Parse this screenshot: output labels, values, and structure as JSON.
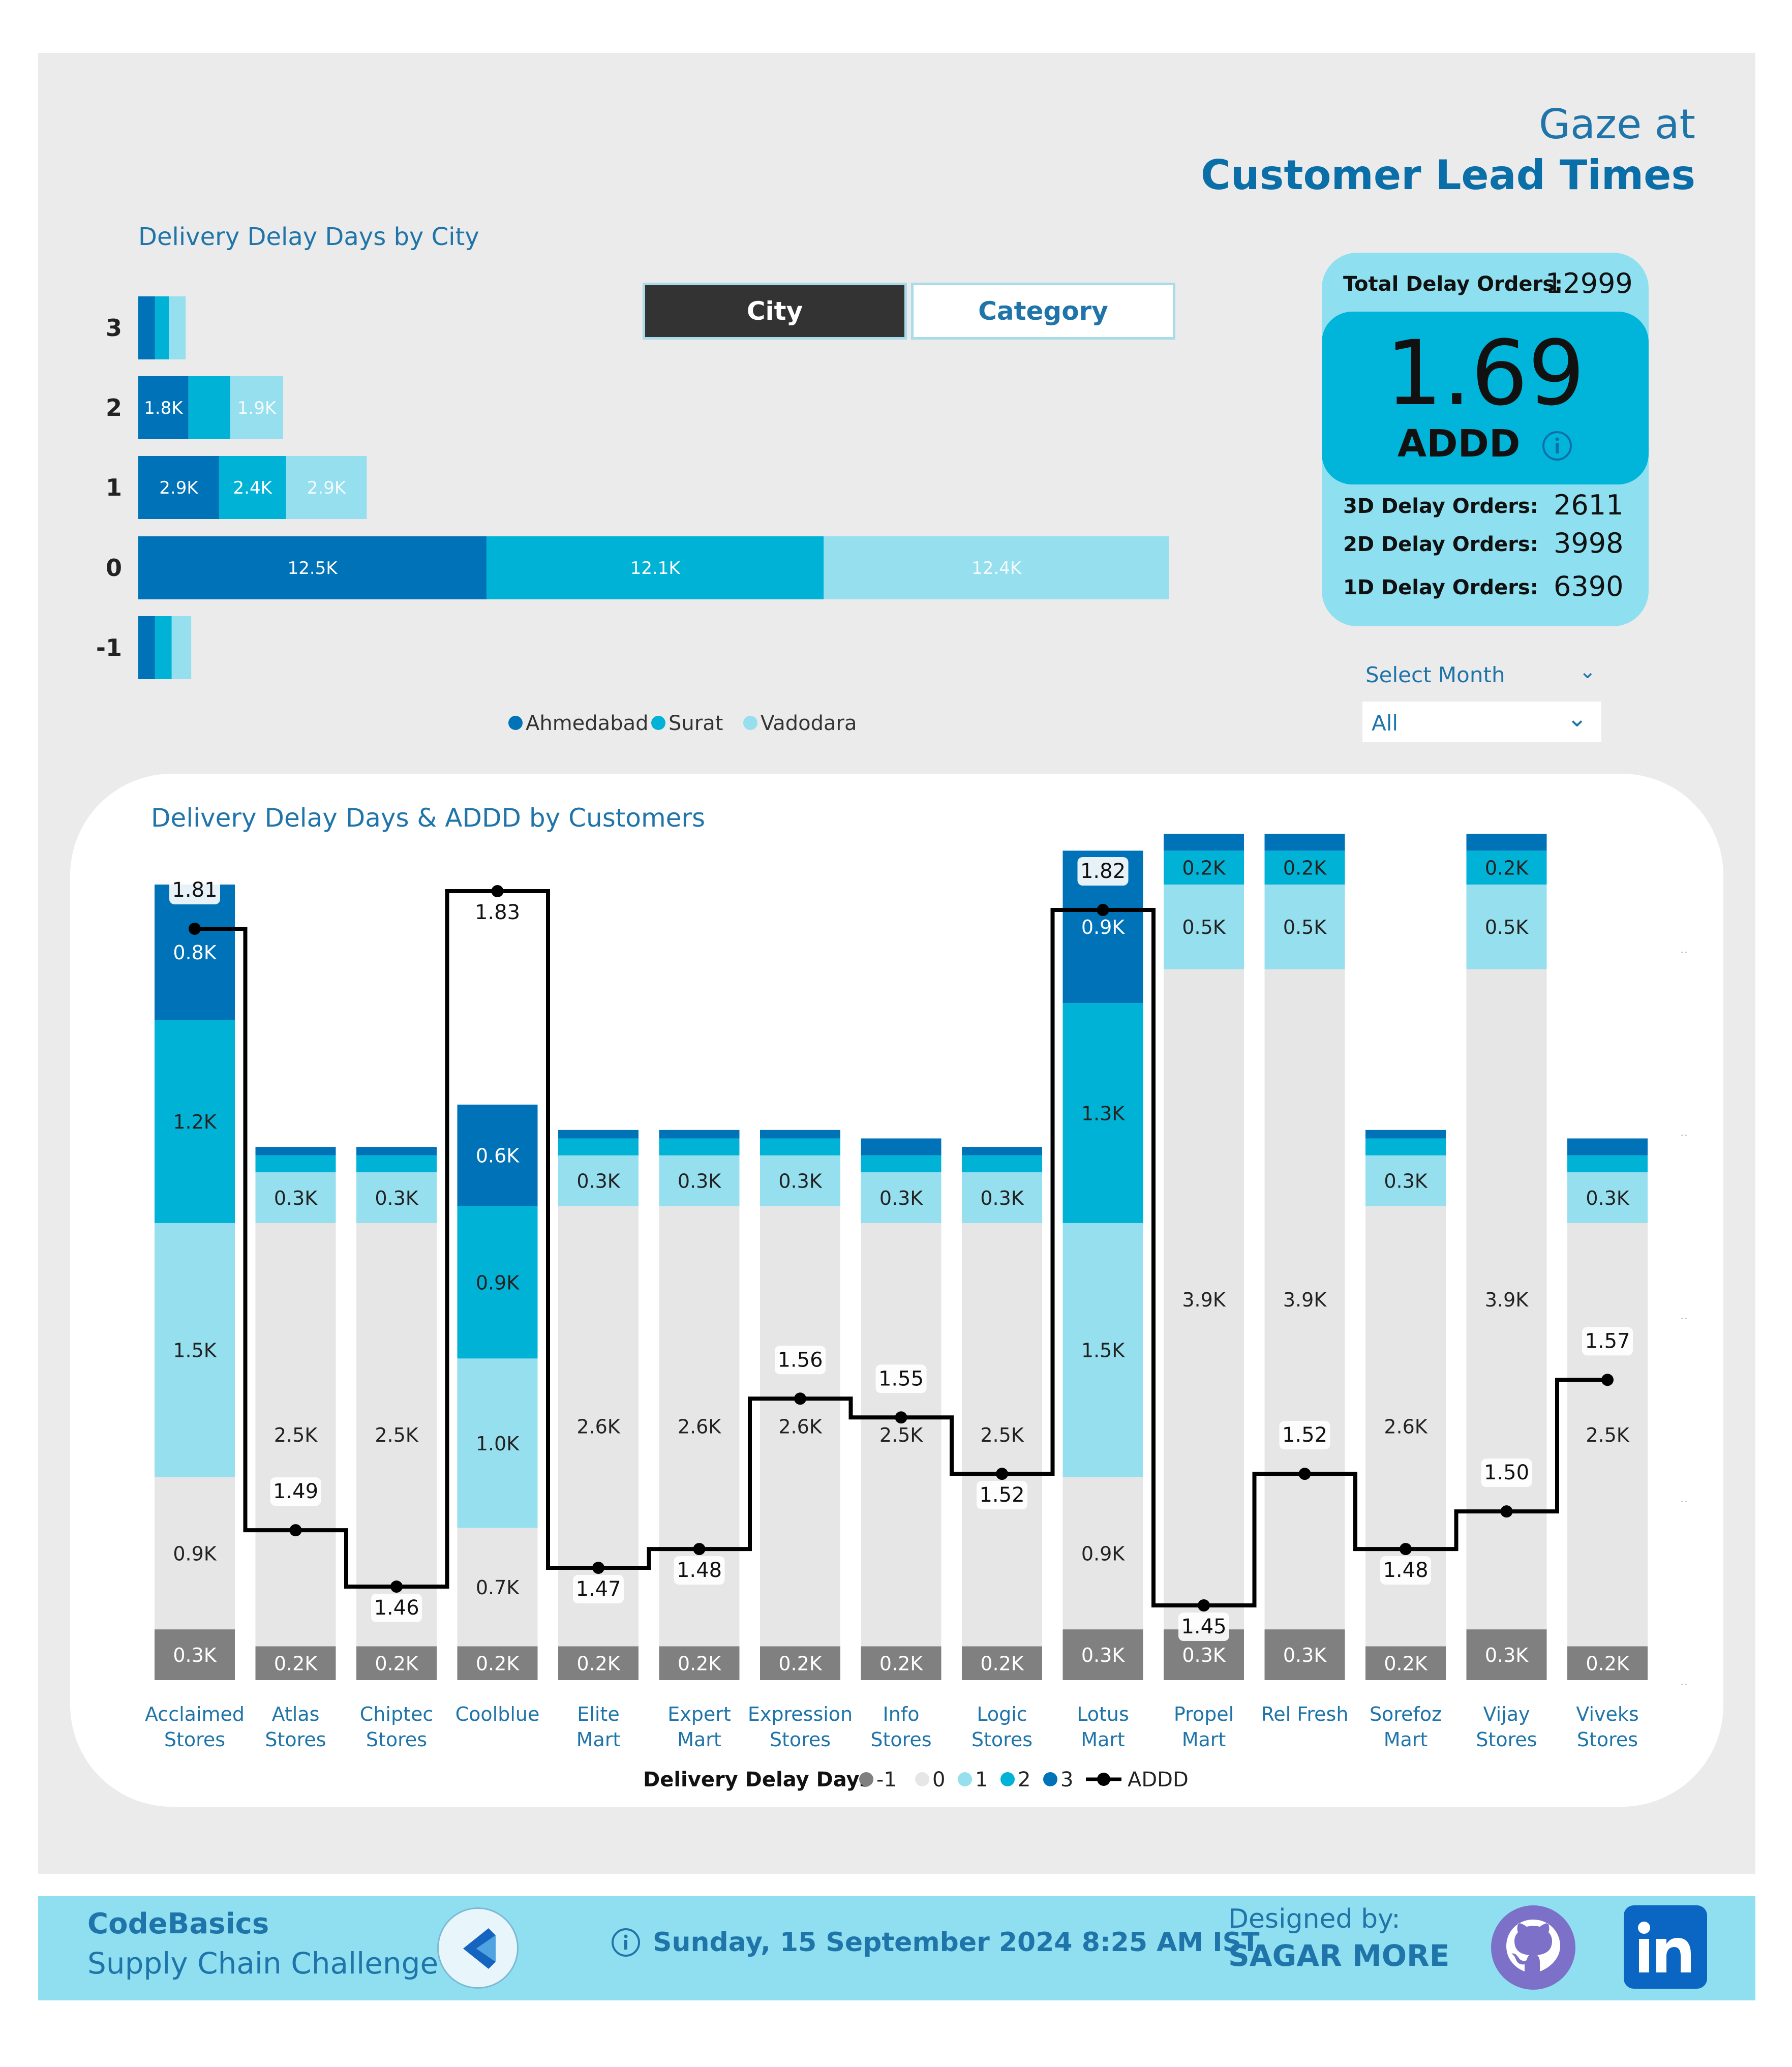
{
  "header": {
    "line1": "Gaze at",
    "line2": "Customer Lead Times"
  },
  "toggle": {
    "city_label": "City",
    "category_label": "Category",
    "selected": "City"
  },
  "kpi": {
    "total_label": "Total Delay Orders:",
    "total_value": "12999",
    "big_value": "1.69",
    "big_label": "ADDD",
    "d3_label": "3D Delay Orders:",
    "d3_value": "2611",
    "d2_label": "2D Delay Orders:",
    "d2_value": "3998",
    "d1_label": "1D Delay Orders:",
    "d1_value": "6390"
  },
  "month_filter": {
    "label": "Select Month",
    "value": "All"
  },
  "footer": {
    "brand_line1": "CodeBasics",
    "brand_line2": "Supply Chain Challenge",
    "date": "Sunday, 15 September 2024 8:25 AM IST",
    "designed_label": "Designed by:",
    "designer": "SAGAR MORE"
  },
  "colors": {
    "ahmedabad": "#0072b8",
    "surat": "#00b3d6",
    "vadodara": "#96dfee",
    "minus1": "#808080",
    "zero": "#e6e6e6",
    "one": "#96dfee",
    "two": "#00b3d6",
    "three": "#0072b8"
  },
  "chart_data": [
    {
      "type": "bar",
      "title": "Delivery Delay Days by City",
      "orientation": "horizontal",
      "stacked": true,
      "categories": [
        "3",
        "2",
        "1",
        "0",
        "-1"
      ],
      "series": [
        {
          "name": "Ahmedabad",
          "values": [
            0.6,
            1.8,
            2.9,
            12.5,
            0.6
          ],
          "labels": [
            "",
            "1.8K",
            "2.9K",
            "12.5K",
            ""
          ]
        },
        {
          "name": "Surat",
          "values": [
            0.5,
            1.5,
            2.4,
            12.1,
            0.6
          ],
          "labels": [
            "",
            "",
            "2.4K",
            "12.1K",
            ""
          ]
        },
        {
          "name": "Vadodara",
          "values": [
            0.6,
            1.9,
            2.9,
            12.4,
            0.7
          ],
          "labels": [
            "",
            "1.9K",
            "2.9K",
            "12.4K",
            ""
          ]
        }
      ],
      "legend": "bottom"
    },
    {
      "type": "bar",
      "title": "Delivery Delay Days & ADDD by Customers",
      "stacked": true,
      "categories": [
        "Acclaimed Stores",
        "Atlas Stores",
        "Chiptec Stores",
        "Coolblue",
        "Elite Mart",
        "Expert Mart",
        "Expression Stores",
        "Info Stores",
        "Logic Stores",
        "Lotus Mart",
        "Propel Mart",
        "Rel Fresh",
        "Sorefoz Mart",
        "Vijay Stores",
        "Viveks Stores"
      ],
      "legend_title": "Delivery Delay Days",
      "series": [
        {
          "name": "-1",
          "values": [
            0.3,
            0.2,
            0.2,
            0.2,
            0.2,
            0.2,
            0.2,
            0.2,
            0.2,
            0.3,
            0.3,
            0.3,
            0.2,
            0.3,
            0.2
          ]
        },
        {
          "name": "0",
          "values": [
            0.9,
            2.5,
            2.5,
            0.7,
            2.6,
            2.6,
            2.6,
            2.5,
            2.5,
            0.9,
            3.9,
            3.9,
            2.6,
            3.9,
            2.5
          ]
        },
        {
          "name": "1",
          "values": [
            1.5,
            0.3,
            0.3,
            1.0,
            0.3,
            0.3,
            0.3,
            0.3,
            0.3,
            1.5,
            0.5,
            0.5,
            0.3,
            0.5,
            0.3
          ]
        },
        {
          "name": "2",
          "values": [
            1.2,
            0.1,
            0.1,
            0.9,
            0.1,
            0.1,
            0.1,
            0.1,
            0.1,
            1.3,
            0.2,
            0.2,
            0.1,
            0.2,
            0.1
          ]
        },
        {
          "name": "3",
          "values": [
            0.8,
            0.05,
            0.05,
            0.6,
            0.05,
            0.05,
            0.05,
            0.1,
            0.05,
            0.9,
            0.1,
            0.1,
            0.05,
            0.1,
            0.1
          ]
        }
      ],
      "value_labels": {
        "-1": [
          "0.3K",
          "0.2K",
          "0.2K",
          "0.2K",
          "0.2K",
          "0.2K",
          "0.2K",
          "0.2K",
          "0.2K",
          "0.3K",
          "0.3K",
          "0.3K",
          "0.2K",
          "0.3K",
          "0.2K"
        ],
        "0": [
          "0.9K",
          "2.5K",
          "2.5K",
          "0.7K",
          "2.6K",
          "2.6K",
          "2.6K",
          "2.5K",
          "2.5K",
          "0.9K",
          "3.9K",
          "3.9K",
          "2.6K",
          "3.9K",
          "2.5K"
        ],
        "1": [
          "1.5K",
          "0.3K",
          "0.3K",
          "1.0K",
          "0.3K",
          "0.3K",
          "0.3K",
          "0.3K",
          "0.3K",
          "1.5K",
          "0.5K",
          "0.5K",
          "0.3K",
          "0.5K",
          "0.3K"
        ],
        "2": [
          "1.2K",
          "",
          "",
          "0.9K",
          "",
          "",
          "",
          "",
          "",
          "1.3K",
          "0.2K",
          "0.2K",
          "",
          "0.2K",
          ""
        ],
        "3": [
          "0.8K",
          "",
          "",
          "0.6K",
          "",
          "",
          "",
          "",
          "",
          "0.9K",
          "",
          "",
          "",
          "",
          ""
        ]
      },
      "line": {
        "name": "ADDD",
        "values": [
          1.81,
          1.49,
          1.46,
          1.83,
          1.47,
          1.48,
          1.56,
          1.55,
          1.52,
          1.82,
          1.45,
          1.52,
          1.48,
          1.5,
          1.57
        ],
        "step": true
      },
      "legend": "bottom"
    }
  ]
}
